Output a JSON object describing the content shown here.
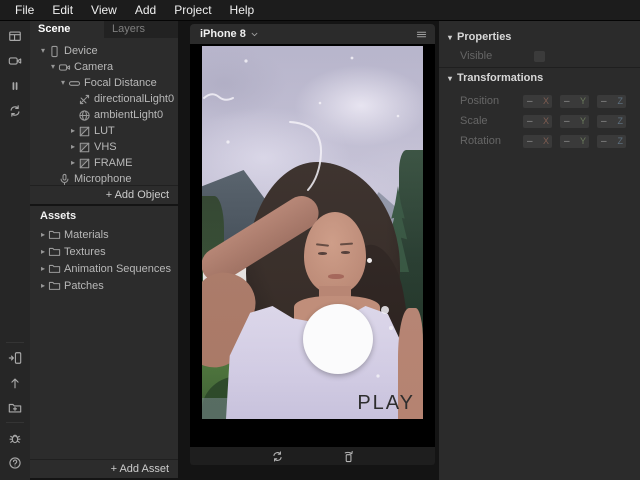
{
  "menubar": {
    "items": [
      {
        "label": "File"
      },
      {
        "label": "Edit"
      },
      {
        "label": "View"
      },
      {
        "label": "Add"
      },
      {
        "label": "Project"
      },
      {
        "label": "Help"
      }
    ]
  },
  "toolstrip": {
    "top": [
      {
        "icon": "panels-icon"
      },
      {
        "icon": "video-camera-icon"
      },
      {
        "icon": "pause-icon"
      },
      {
        "icon": "sync-icon"
      }
    ],
    "bottom": [
      {
        "icon": "send-to-device-icon"
      },
      {
        "icon": "publish-icon"
      },
      {
        "icon": "export-icon"
      },
      {
        "icon": "bug-icon"
      },
      {
        "icon": "help-icon"
      }
    ]
  },
  "scene_panel": {
    "tab_scene": "Scene",
    "tab_layers": "Layers",
    "tree": [
      {
        "label": "Device",
        "icon": "phone-icon",
        "depth": 0,
        "arrow": "expanded"
      },
      {
        "label": "Camera",
        "icon": "camera-icon",
        "depth": 1,
        "arrow": "expanded"
      },
      {
        "label": "Focal Distance",
        "icon": "focal-distance-icon",
        "depth": 2,
        "arrow": "expanded"
      },
      {
        "label": "directionalLight0",
        "icon": "directional-light-icon",
        "depth": 3,
        "arrow": "none"
      },
      {
        "label": "ambientLight0",
        "icon": "ambient-light-icon",
        "depth": 3,
        "arrow": "none"
      },
      {
        "label": "LUT",
        "icon": "canvas-icon",
        "depth": 3,
        "arrow": "collapsed"
      },
      {
        "label": "VHS",
        "icon": "canvas-icon",
        "depth": 3,
        "arrow": "collapsed"
      },
      {
        "label": "FRAME",
        "icon": "canvas-icon",
        "depth": 3,
        "arrow": "collapsed"
      },
      {
        "label": "Microphone",
        "icon": "mic-icon",
        "depth": 1,
        "arrow": "none"
      }
    ],
    "add_object": "+ Add Object"
  },
  "assets_panel": {
    "title": "Assets",
    "items": [
      {
        "label": "Materials",
        "icon": "folder-icon",
        "arrow": "collapsed"
      },
      {
        "label": "Textures",
        "icon": "folder-icon",
        "arrow": "collapsed"
      },
      {
        "label": "Animation Sequences",
        "icon": "folder-icon",
        "arrow": "collapsed"
      },
      {
        "label": "Patches",
        "icon": "folder-icon",
        "arrow": "collapsed"
      }
    ],
    "add_asset": "+ Add Asset"
  },
  "preview": {
    "device": "iPhone 8",
    "play_label": "PLAY",
    "controls": [
      {
        "icon": "restart-icon"
      },
      {
        "icon": "rotate-device-icon"
      }
    ]
  },
  "properties_panel": {
    "properties_title": "Properties",
    "visible_label": "Visible",
    "visible_checked": false,
    "transformations_title": "Transformations",
    "rows": [
      {
        "label": "Position",
        "axes": [
          {
            "axis": "X",
            "value": "–"
          },
          {
            "axis": "Y",
            "value": "–"
          },
          {
            "axis": "Z",
            "value": "–"
          }
        ]
      },
      {
        "label": "Scale",
        "axes": [
          {
            "axis": "X",
            "value": "–"
          },
          {
            "axis": "Y",
            "value": "–"
          },
          {
            "axis": "Z",
            "value": "–"
          }
        ]
      },
      {
        "label": "Rotation",
        "axes": [
          {
            "axis": "X",
            "value": "–"
          },
          {
            "axis": "Y",
            "value": "–"
          },
          {
            "axis": "Z",
            "value": "–"
          }
        ]
      }
    ]
  },
  "colors": {
    "panel_bg": "#2c2c2c",
    "chrome_bg": "#1c1c1c",
    "simulator_bg": "#000000",
    "tap_circle": "#fbfbfc"
  }
}
